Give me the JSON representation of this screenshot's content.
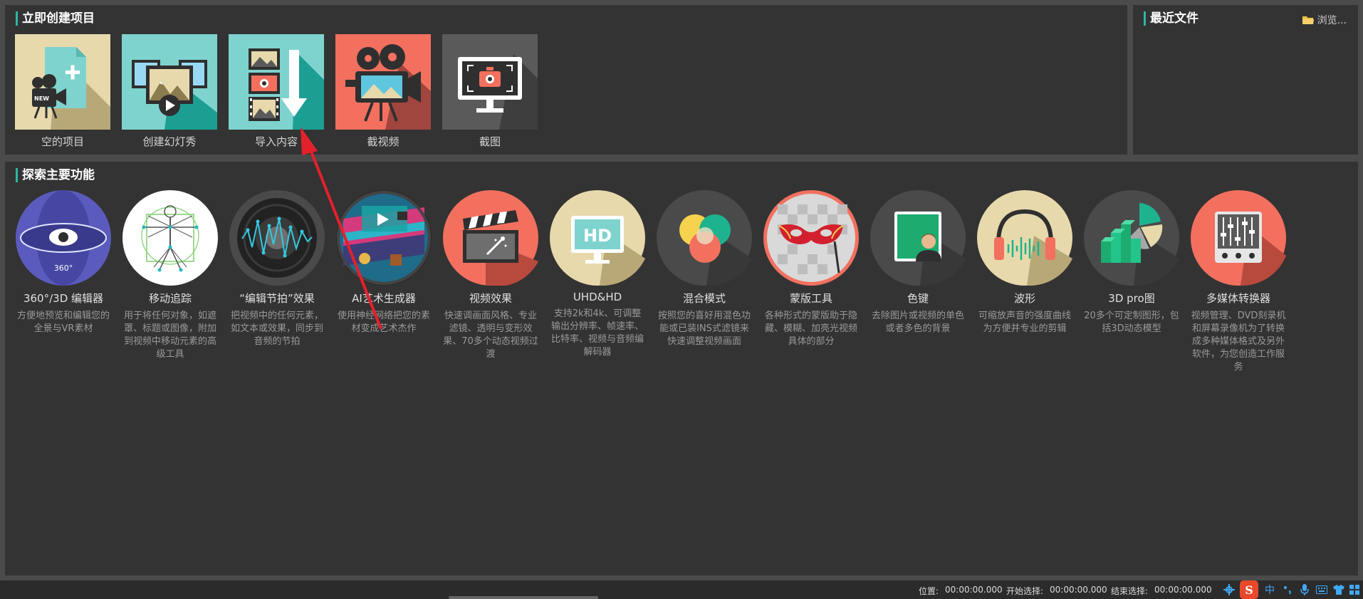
{
  "create_section": {
    "title": "立即创建项目",
    "tiles": [
      {
        "label": "空的项目",
        "icon": "new-project-icon"
      },
      {
        "label": "创建幻灯秀",
        "icon": "slideshow-icon"
      },
      {
        "label": "导入内容",
        "icon": "import-content-icon"
      },
      {
        "label": "截视频",
        "icon": "screen-record-icon"
      },
      {
        "label": "截图",
        "icon": "screenshot-icon"
      }
    ]
  },
  "recent_section": {
    "title": "最近文件",
    "browse_label": "浏览..."
  },
  "explore_section": {
    "title": "探索主要功能",
    "features": [
      {
        "title": "360°/3D 编辑器",
        "desc": "方便地预览和编辑您的全景与VR素材",
        "icon": "360-editor-icon",
        "icon_text": "360°"
      },
      {
        "title": "移动追踪",
        "desc": "用于将任何对象，如遮罩、标题或图像，附加到视频中移动元素的高级工具",
        "icon": "motion-tracking-icon"
      },
      {
        "title": "“编辑节拍”效果",
        "desc": "把视频中的任何元素，如文本或效果，同步到音频的节拍",
        "icon": "beat-edit-icon"
      },
      {
        "title": "AI艺术生成器",
        "desc": "使用神经网络把您的素材变成艺术杰作",
        "icon": "ai-art-icon"
      },
      {
        "title": "视频效果",
        "desc": "快速调画面风格、专业滤镜、透明与变形效果、70多个动态视频过渡",
        "icon": "clapperboard-icon"
      },
      {
        "title": "UHD&HD",
        "desc": "支持2k和4k、可调整输出分辨率、帧速率、比特率、视频与音频编解码器",
        "icon": "hd-monitor-icon",
        "icon_text": "HD"
      },
      {
        "title": "混合模式",
        "desc": "按照您的喜好用混色功能或已装INS式滤镜来快速调整视频画面",
        "icon": "blend-modes-icon"
      },
      {
        "title": "蒙版工具",
        "desc": "各种形式的蒙版助于隐藏、模糊、加亮光视频具体的部分",
        "icon": "mask-tool-icon"
      },
      {
        "title": "色键",
        "desc": "去除图片或视频的单色或者多色的背景",
        "icon": "chroma-key-icon"
      },
      {
        "title": "波形",
        "desc": "可缩放声音的强度曲线为方便并专业的剪辑",
        "icon": "waveform-icon"
      },
      {
        "title": "3D pro图",
        "desc": "20多个可定制图形，包括3D动态模型",
        "icon": "3d-chart-icon"
      },
      {
        "title": "多媒体转换器",
        "desc": "视频管理、DVD刻录机和屏幕录像机为了转换成多种媒体格式及另外软件，为您创造工作服务",
        "icon": "media-converter-icon"
      }
    ]
  },
  "status_bar": {
    "position_label": "位置:",
    "position_value": "00:00:00.000",
    "sel_start_label": "开始选择:",
    "sel_start_value": "00:00:00.000",
    "sel_end_label": "结束选择:",
    "sel_end_value": "00:00:00.000",
    "ime_mode": "中"
  },
  "colors": {
    "accent": "#2db6a3",
    "panel_bg": "#333333",
    "page_bg": "#4b4b4b",
    "arrow": "#e3212b"
  }
}
